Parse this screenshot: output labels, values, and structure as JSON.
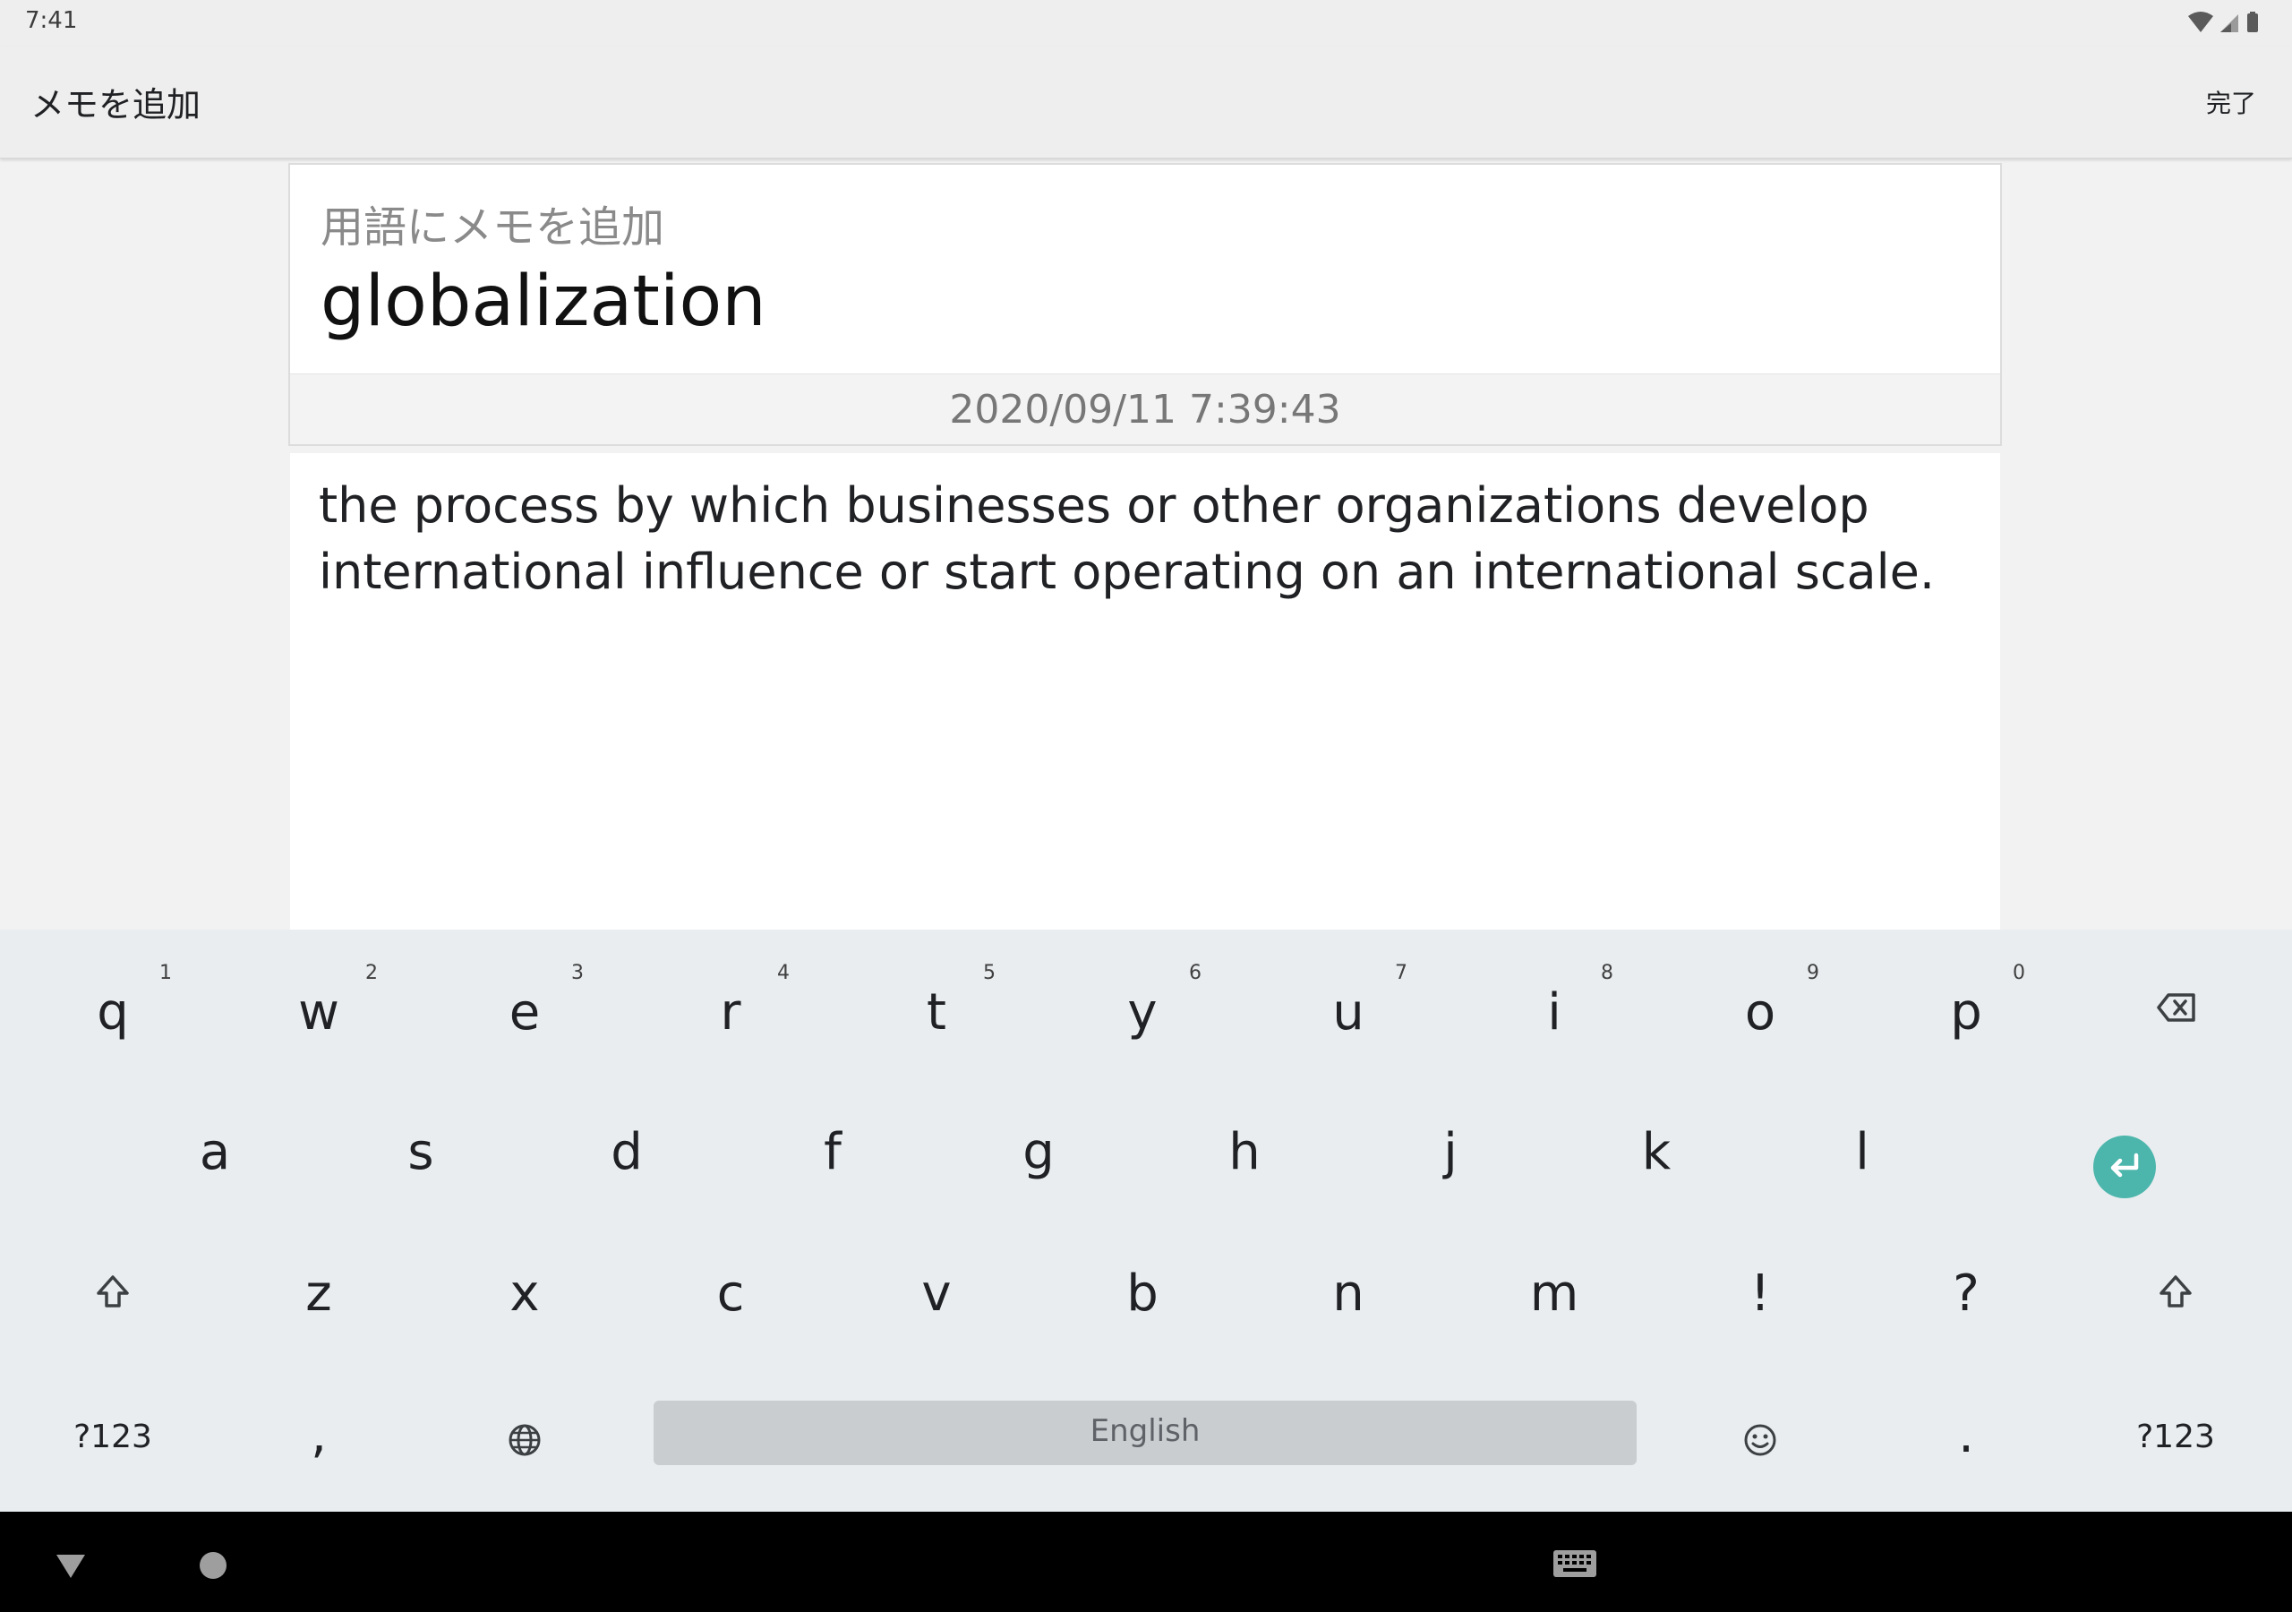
{
  "status_bar": {
    "time": "7:41"
  },
  "app_bar": {
    "title": "メモを追加",
    "done_label": "完了"
  },
  "card": {
    "subtitle": "用語にメモを追加",
    "term": "globalization",
    "timestamp": "2020/09/11 7:39:43"
  },
  "memo": {
    "text": "the process by which businesses or other organizations develop international influence or start operating on an international scale."
  },
  "keyboard": {
    "row1": [
      {
        "key": "q",
        "hint": "1"
      },
      {
        "key": "w",
        "hint": "2"
      },
      {
        "key": "e",
        "hint": "3"
      },
      {
        "key": "r",
        "hint": "4"
      },
      {
        "key": "t",
        "hint": "5"
      },
      {
        "key": "y",
        "hint": "6"
      },
      {
        "key": "u",
        "hint": "7"
      },
      {
        "key": "i",
        "hint": "8"
      },
      {
        "key": "o",
        "hint": "9"
      },
      {
        "key": "p",
        "hint": "0"
      }
    ],
    "row2": [
      "a",
      "s",
      "d",
      "f",
      "g",
      "h",
      "j",
      "k",
      "l"
    ],
    "row3": [
      "z",
      "x",
      "c",
      "v",
      "b",
      "n",
      "m",
      "!",
      "?"
    ],
    "symbols_label": "?123",
    "comma_label": ",",
    "period_label": ".",
    "space_label": "English",
    "icons": {
      "backspace": "backspace-icon",
      "enter": "enter-icon",
      "shift": "shift-icon",
      "globe": "globe-icon",
      "emoji": "emoji-icon"
    },
    "enter_color": "#4db6ac"
  },
  "nav_bar": {
    "icons": [
      "back-triangle-icon",
      "home-circle-icon",
      "keyboard-switch-icon"
    ]
  }
}
